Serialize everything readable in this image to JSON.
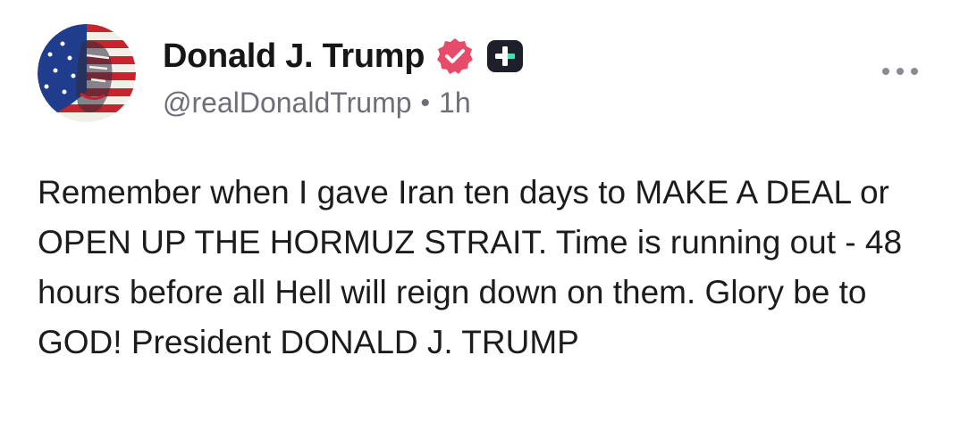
{
  "author": {
    "display_name": "Donald J. Trump",
    "handle": "@realDonaldTrump",
    "separator": "•",
    "timestamp": "1h",
    "avatar_icon": "flag-portrait-avatar",
    "verified_icon": "verified-badge-icon",
    "plus_icon": "plus-badge-icon"
  },
  "post": {
    "text": "Remember when I gave Iran ten days to MAKE A DEAL or OPEN UP THE HORMUZ STRAIT. Time is running out - 48 hours before all Hell will reign down on them. Glory be to GOD! President DONALD J. TRUMP"
  },
  "actions": {
    "more_icon": "more-options-icon"
  },
  "colors": {
    "verified": "#e64c6a",
    "plus_badge": "#1d1f2a",
    "plus_accent": "#3fe0b5",
    "handle_text": "#6e6e78",
    "body_text": "#1c1c1c"
  }
}
